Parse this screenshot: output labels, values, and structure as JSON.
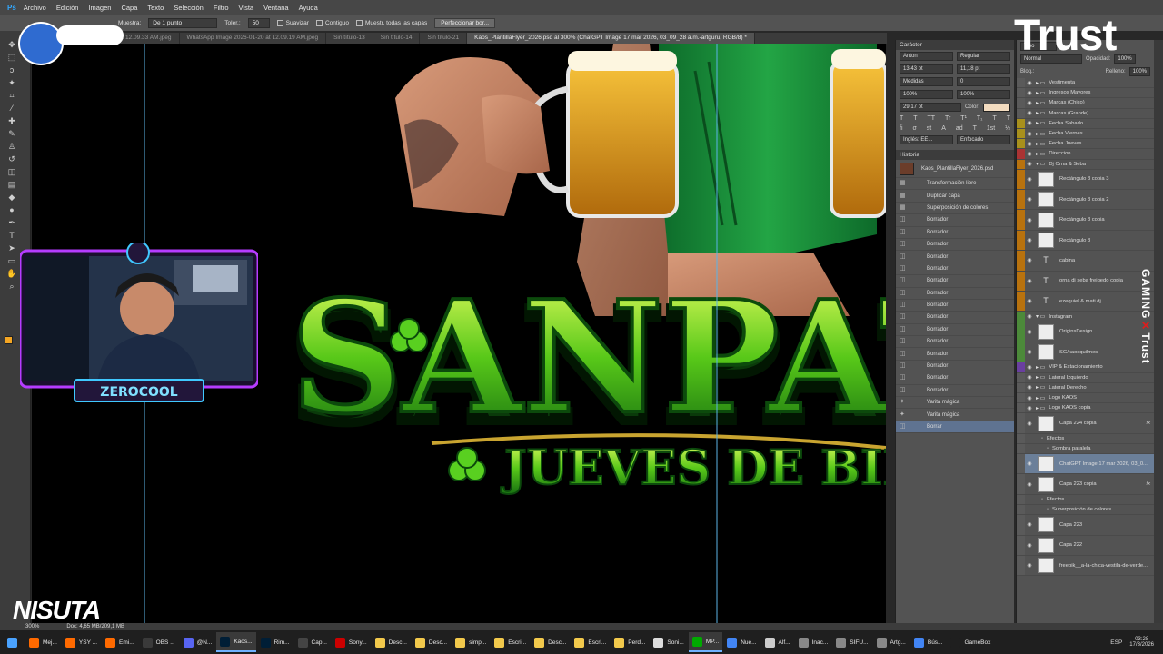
{
  "menu": {
    "app": "Ps",
    "items": [
      "Archivo",
      "Edición",
      "Imagen",
      "Capa",
      "Texto",
      "Selección",
      "Filtro",
      "Vista",
      "Ventana",
      "Ayuda"
    ]
  },
  "options": {
    "muestra_label": "Muestra:",
    "muestra_value": "De 1 punto",
    "tolerancia_label": "Toler.:",
    "tolerancia_value": "50",
    "suavizar": "Suavizar",
    "contiguo": "Contiguo",
    "muestrear": "Muestr. todas las capas",
    "perfeccionar": "Perfeccionar bor..."
  },
  "tabs": [
    "WhatsApp Image 2026-01-20 at 12.09.33 AM.jpeg",
    "WhatsApp Image 2026-01-20 at 12.09.19 AM.jpeg",
    "Sin título-13",
    "Sin título-14",
    "Sin título-21",
    "Kaos_PlantillaFlyer_2026.psd al 300% (ChatGPT Image 17 mar 2026, 03_09_28 a.m.-artguru, RGB/8) *"
  ],
  "canvas": {
    "title_main": "SANPATR",
    "subtitle": "JUEVES DE BIRR"
  },
  "character": {
    "title": "Carácter",
    "font": "Anton",
    "style": "Regular",
    "size": "13,43 pt",
    "leading": "11,18 pt",
    "kerning": "Medidas",
    "tracking": "0",
    "vscale": "100%",
    "hscale": "100%",
    "baseline": "29,17 pt",
    "color_label": "Color:",
    "lang": "Inglés: EE...",
    "aa": "Enfocado",
    "styles": [
      "T",
      "T",
      "TT",
      "Tr",
      "T¹",
      "T₁",
      "T",
      "T"
    ],
    "ot": [
      "fi",
      "σ",
      "st",
      "A",
      "ad",
      "T",
      "1st",
      "½"
    ]
  },
  "history": {
    "title": "Historia",
    "doc": "Kaos_PlantillaFlyer_2026.psd",
    "items": [
      "Transformación libre",
      "Duplicar capa",
      "Superposición de colores",
      "Borrador",
      "Borrador",
      "Borrador",
      "Borrador",
      "Borrador",
      "Borrador",
      "Borrador",
      "Borrador",
      "Borrador",
      "Borrador",
      "Borrador",
      "Borrador",
      "Borrador",
      "Borrador",
      "Borrador",
      "Varita mágica",
      "Varita mágica",
      "Borrar"
    ]
  },
  "layers": {
    "filter": "Tipo",
    "mode": "Normal",
    "opacity_label": "Opacidad:",
    "opacity": "100%",
    "fill_label": "Relleno:",
    "fill": "100%",
    "lock_label": "Bloq.:",
    "rows": [
      {
        "name": "Vestimenta",
        "kind": "folder",
        "color": "#5a5a5a"
      },
      {
        "name": "Ingresos Mayores",
        "kind": "folder",
        "color": "#5a5a5a"
      },
      {
        "name": "Marcas (Chico)",
        "kind": "folder",
        "color": "#5a5a5a"
      },
      {
        "name": "Marcas (Grande)",
        "kind": "folder",
        "color": "#5a5a5a"
      },
      {
        "name": "Fecha Sabado",
        "kind": "folder",
        "color": "#a8901c"
      },
      {
        "name": "Fecha Viernes",
        "kind": "folder",
        "color": "#a8901c"
      },
      {
        "name": "Fecha Jueves",
        "kind": "folder",
        "color": "#a8901c"
      },
      {
        "name": "Direccion",
        "kind": "folder",
        "color": "#a33"
      },
      {
        "name": "Dj Orna & Seba",
        "kind": "group",
        "color": "#b8720e"
      },
      {
        "name": "Rectángulo 3 copia 3",
        "kind": "thumb",
        "color": "#b8720e"
      },
      {
        "name": "Rectángulo 3 copia 2",
        "kind": "thumb",
        "color": "#b8720e"
      },
      {
        "name": "Rectángulo 3 copia",
        "kind": "thumb",
        "color": "#b8720e"
      },
      {
        "name": "Rectángulo 3",
        "kind": "thumb",
        "color": "#b8720e"
      },
      {
        "name": "cabina",
        "kind": "text",
        "color": "#b8720e"
      },
      {
        "name": "orna dj seba freigedo copia",
        "kind": "text",
        "color": "#b8720e"
      },
      {
        "name": "ezequiel & mati dj",
        "kind": "text",
        "color": "#b8720e"
      },
      {
        "name": "Instagram",
        "kind": "group",
        "color": "#4c8a3a"
      },
      {
        "name": "OriginsDesign",
        "kind": "thumb",
        "color": "#4c8a3a"
      },
      {
        "name": "SG/kaosquilmes",
        "kind": "thumb",
        "color": "#4c8a3a"
      },
      {
        "name": "VIP & Estacionamiento",
        "kind": "folder",
        "color": "#6a3fa0"
      },
      {
        "name": "Lateral Izquierdo",
        "kind": "folder",
        "color": "#5a5a5a"
      },
      {
        "name": "Lateral Derecho",
        "kind": "folder",
        "color": "#5a5a5a"
      },
      {
        "name": "Logo KAOS",
        "kind": "folder",
        "color": "#5a5a5a"
      },
      {
        "name": "Logo KAOS copia",
        "kind": "folder",
        "color": "#5a5a5a"
      },
      {
        "name": "Capa 224 copia",
        "kind": "thumb",
        "color": "#5a5a5a",
        "fx": "fx"
      },
      {
        "name": "Efectos",
        "kind": "sub",
        "color": "#5a5a5a"
      },
      {
        "name": "Sombra paralela",
        "kind": "sub2",
        "color": "#5a5a5a"
      },
      {
        "name": "ChatGPT Image 17 mar 2026, 03_0...",
        "kind": "thumb",
        "color": "#5a5a5a",
        "selected": true
      },
      {
        "name": "Capa 223 copia",
        "kind": "thumb",
        "color": "#5a5a5a",
        "fx": "fx"
      },
      {
        "name": "Efectos",
        "kind": "sub",
        "color": "#5a5a5a"
      },
      {
        "name": "Superposición de colores",
        "kind": "sub2",
        "color": "#5a5a5a"
      },
      {
        "name": "Capa 223",
        "kind": "thumb",
        "color": "#5a5a5a"
      },
      {
        "name": "Capa 222",
        "kind": "thumb",
        "color": "#5a5a5a"
      },
      {
        "name": "freepik__a-la-chica-vestila-de-verde...",
        "kind": "thumb",
        "color": "#5a5a5a"
      }
    ]
  },
  "status": {
    "zoom": "300%",
    "doc": "Doc: 4,65 MB/209,1 MB"
  },
  "taskbar": {
    "items": [
      {
        "label": "Mej...",
        "color": "#ff6a00"
      },
      {
        "label": "YSY ...",
        "color": "#ff6a00"
      },
      {
        "label": "Emi...",
        "color": "#ff6a00"
      },
      {
        "label": "OBS ...",
        "color": "#3a3a3a"
      },
      {
        "label": "@N...",
        "color": "#5865f2"
      },
      {
        "label": "Kaos...",
        "color": "#001e36",
        "active": true
      },
      {
        "label": "Rim...",
        "color": "#001e36"
      },
      {
        "label": "Cap...",
        "color": "#444"
      },
      {
        "label": "Sony...",
        "color": "#c00"
      },
      {
        "label": "Desc...",
        "color": "#f2c94c"
      },
      {
        "label": "Desc...",
        "color": "#f2c94c"
      },
      {
        "label": "simp...",
        "color": "#f2c94c"
      },
      {
        "label": "Escri...",
        "color": "#f2c94c"
      },
      {
        "label": "Desc...",
        "color": "#f2c94c"
      },
      {
        "label": "Escri...",
        "color": "#f2c94c"
      },
      {
        "label": "Perd...",
        "color": "#f2c94c"
      },
      {
        "label": "Soni...",
        "color": "#ddd"
      },
      {
        "label": "MP...",
        "color": "#0a0",
        "active": true
      },
      {
        "label": "Nue...",
        "color": "#4285f4"
      },
      {
        "label": "Alf...",
        "color": "#ccc"
      },
      {
        "label": "Inac...",
        "color": "#888"
      },
      {
        "label": "SIFU...",
        "color": "#888"
      },
      {
        "label": "Artg...",
        "color": "#888"
      },
      {
        "label": "Bús...",
        "color": "#4285f4"
      },
      {
        "label": "GameBox",
        "color": "#1f1f1f"
      }
    ],
    "lang": "ESP",
    "time": "03:28",
    "date": "17/3/2026"
  },
  "overlay": {
    "trust": "Trust",
    "gaming_trust": "GAMING",
    "gaming_trust2": "Trust",
    "nisuta": "NISUTA",
    "webcam_name": "ZEROCOOL"
  }
}
